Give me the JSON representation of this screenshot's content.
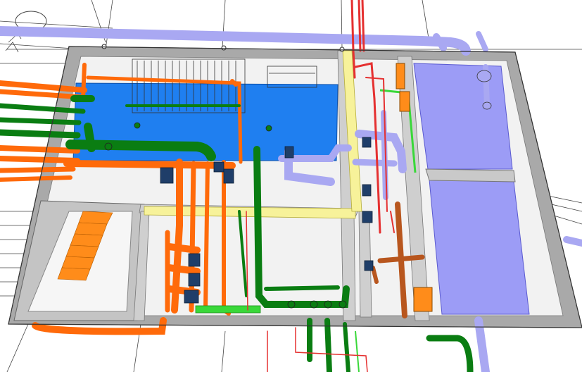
{
  "view": {
    "kind": "3D isometric BIM pump room model",
    "systems": [
      {
        "name": "chilled-water",
        "color": "#0a7d12"
      },
      {
        "name": "heating-water",
        "color": "#ff6a0a"
      },
      {
        "name": "drainage",
        "color": "#a9a8f2"
      },
      {
        "name": "fire-water",
        "color": "#e53030"
      },
      {
        "name": "return-water",
        "color": "#b8561e"
      },
      {
        "name": "grid-lines",
        "color": "#111111"
      }
    ]
  },
  "colors": {
    "wall_top": "#b8b8b8",
    "wall_dark": "#8d8d8d",
    "floor": "#f3f3f3",
    "tank_blue": "#1f7ff0",
    "tank_purple": "#9c9cf6",
    "yellow_beam": "#f7f29a",
    "stair": "#ff8c1a",
    "equipment_navy": "#1f3e69",
    "bright_green": "#39d839"
  }
}
